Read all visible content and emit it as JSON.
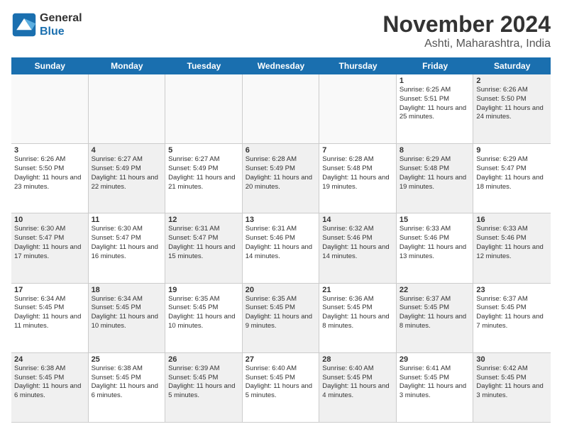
{
  "logo": {
    "line1": "General",
    "line2": "Blue"
  },
  "title": "November 2024",
  "subtitle": "Ashti, Maharashtra, India",
  "days": [
    "Sunday",
    "Monday",
    "Tuesday",
    "Wednesday",
    "Thursday",
    "Friday",
    "Saturday"
  ],
  "weeks": [
    [
      {
        "day": "",
        "info": "",
        "empty": true
      },
      {
        "day": "",
        "info": "",
        "empty": true
      },
      {
        "day": "",
        "info": "",
        "empty": true
      },
      {
        "day": "",
        "info": "",
        "empty": true
      },
      {
        "day": "",
        "info": "",
        "empty": true
      },
      {
        "day": "1",
        "info": "Sunrise: 6:25 AM\nSunset: 5:51 PM\nDaylight: 11 hours and 25 minutes."
      },
      {
        "day": "2",
        "info": "Sunrise: 6:26 AM\nSunset: 5:50 PM\nDaylight: 11 hours and 24 minutes.",
        "shaded": true
      }
    ],
    [
      {
        "day": "3",
        "info": "Sunrise: 6:26 AM\nSunset: 5:50 PM\nDaylight: 11 hours and 23 minutes."
      },
      {
        "day": "4",
        "info": "Sunrise: 6:27 AM\nSunset: 5:49 PM\nDaylight: 11 hours and 22 minutes.",
        "shaded": true
      },
      {
        "day": "5",
        "info": "Sunrise: 6:27 AM\nSunset: 5:49 PM\nDaylight: 11 hours and 21 minutes."
      },
      {
        "day": "6",
        "info": "Sunrise: 6:28 AM\nSunset: 5:49 PM\nDaylight: 11 hours and 20 minutes.",
        "shaded": true
      },
      {
        "day": "7",
        "info": "Sunrise: 6:28 AM\nSunset: 5:48 PM\nDaylight: 11 hours and 19 minutes."
      },
      {
        "day": "8",
        "info": "Sunrise: 6:29 AM\nSunset: 5:48 PM\nDaylight: 11 hours and 19 minutes.",
        "shaded": true
      },
      {
        "day": "9",
        "info": "Sunrise: 6:29 AM\nSunset: 5:47 PM\nDaylight: 11 hours and 18 minutes."
      }
    ],
    [
      {
        "day": "10",
        "info": "Sunrise: 6:30 AM\nSunset: 5:47 PM\nDaylight: 11 hours and 17 minutes.",
        "shaded": true
      },
      {
        "day": "11",
        "info": "Sunrise: 6:30 AM\nSunset: 5:47 PM\nDaylight: 11 hours and 16 minutes."
      },
      {
        "day": "12",
        "info": "Sunrise: 6:31 AM\nSunset: 5:47 PM\nDaylight: 11 hours and 15 minutes.",
        "shaded": true
      },
      {
        "day": "13",
        "info": "Sunrise: 6:31 AM\nSunset: 5:46 PM\nDaylight: 11 hours and 14 minutes."
      },
      {
        "day": "14",
        "info": "Sunrise: 6:32 AM\nSunset: 5:46 PM\nDaylight: 11 hours and 14 minutes.",
        "shaded": true
      },
      {
        "day": "15",
        "info": "Sunrise: 6:33 AM\nSunset: 5:46 PM\nDaylight: 11 hours and 13 minutes."
      },
      {
        "day": "16",
        "info": "Sunrise: 6:33 AM\nSunset: 5:46 PM\nDaylight: 11 hours and 12 minutes.",
        "shaded": true
      }
    ],
    [
      {
        "day": "17",
        "info": "Sunrise: 6:34 AM\nSunset: 5:45 PM\nDaylight: 11 hours and 11 minutes."
      },
      {
        "day": "18",
        "info": "Sunrise: 6:34 AM\nSunset: 5:45 PM\nDaylight: 11 hours and 10 minutes.",
        "shaded": true
      },
      {
        "day": "19",
        "info": "Sunrise: 6:35 AM\nSunset: 5:45 PM\nDaylight: 11 hours and 10 minutes."
      },
      {
        "day": "20",
        "info": "Sunrise: 6:35 AM\nSunset: 5:45 PM\nDaylight: 11 hours and 9 minutes.",
        "shaded": true
      },
      {
        "day": "21",
        "info": "Sunrise: 6:36 AM\nSunset: 5:45 PM\nDaylight: 11 hours and 8 minutes."
      },
      {
        "day": "22",
        "info": "Sunrise: 6:37 AM\nSunset: 5:45 PM\nDaylight: 11 hours and 8 minutes.",
        "shaded": true
      },
      {
        "day": "23",
        "info": "Sunrise: 6:37 AM\nSunset: 5:45 PM\nDaylight: 11 hours and 7 minutes."
      }
    ],
    [
      {
        "day": "24",
        "info": "Sunrise: 6:38 AM\nSunset: 5:45 PM\nDaylight: 11 hours and 6 minutes.",
        "shaded": true
      },
      {
        "day": "25",
        "info": "Sunrise: 6:38 AM\nSunset: 5:45 PM\nDaylight: 11 hours and 6 minutes."
      },
      {
        "day": "26",
        "info": "Sunrise: 6:39 AM\nSunset: 5:45 PM\nDaylight: 11 hours and 5 minutes.",
        "shaded": true
      },
      {
        "day": "27",
        "info": "Sunrise: 6:40 AM\nSunset: 5:45 PM\nDaylight: 11 hours and 5 minutes."
      },
      {
        "day": "28",
        "info": "Sunrise: 6:40 AM\nSunset: 5:45 PM\nDaylight: 11 hours and 4 minutes.",
        "shaded": true
      },
      {
        "day": "29",
        "info": "Sunrise: 6:41 AM\nSunset: 5:45 PM\nDaylight: 11 hours and 3 minutes."
      },
      {
        "day": "30",
        "info": "Sunrise: 6:42 AM\nSunset: 5:45 PM\nDaylight: 11 hours and 3 minutes.",
        "shaded": true
      }
    ]
  ]
}
